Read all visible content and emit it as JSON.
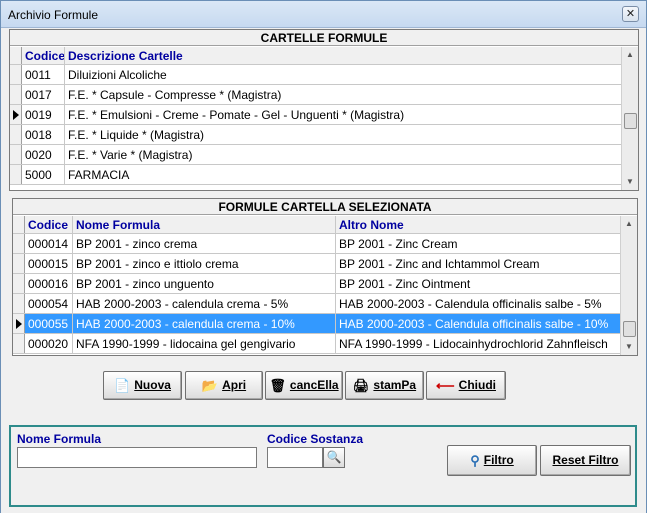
{
  "window": {
    "title": "Archivio Formule",
    "close_glyph": "✕"
  },
  "cartelle": {
    "caption": "CARTELLE FORMULE",
    "columns": [
      "Codice",
      "Descrizione Cartelle"
    ],
    "rows": [
      {
        "codice": "0011",
        "descrizione": "Diluizioni Alcoliche",
        "current": false
      },
      {
        "codice": "0017",
        "descrizione": "F.E. * Capsule - Compresse * (Magistra)",
        "current": false
      },
      {
        "codice": "0019",
        "descrizione": "F.E. * Emulsioni - Creme - Pomate - Gel - Unguenti * (Magistra)",
        "current": true
      },
      {
        "codice": "0018",
        "descrizione": "F.E. * Liquide * (Magistra)",
        "current": false
      },
      {
        "codice": "0020",
        "descrizione": "F.E. * Varie * (Magistra)",
        "current": false
      },
      {
        "codice": "5000",
        "descrizione": "FARMACIA",
        "current": false
      }
    ]
  },
  "formule": {
    "caption": "FORMULE  CARTELLA SELEZIONATA",
    "columns": [
      "Codice",
      "Nome Formula",
      "Altro Nome"
    ],
    "rows": [
      {
        "codice": "000014",
        "nome": "BP 2001 - zinco crema",
        "altro": "BP 2001 - Zinc Cream",
        "selected": false
      },
      {
        "codice": "000015",
        "nome": "BP 2001 - zinco e ittiolo crema",
        "altro": "BP 2001 - Zinc and Ichtammol Cream",
        "selected": false
      },
      {
        "codice": "000016",
        "nome": "BP 2001 - zinco unguento",
        "altro": "BP 2001 - Zinc Ointment",
        "selected": false
      },
      {
        "codice": "000054",
        "nome": "HAB 2000-2003 - calendula crema -  5%",
        "altro": "HAB 2000-2003 - Calendula officinalis salbe -  5%",
        "selected": false
      },
      {
        "codice": "000055",
        "nome": "HAB 2000-2003 - calendula crema - 10%",
        "altro": "HAB 2000-2003 - Calendula officinalis salbe - 10%",
        "selected": true
      },
      {
        "codice": "000020",
        "nome": "NFA 1990-1999 - lidocaina gel gengivario",
        "altro": "NFA 1990-1999 - Lidocainhydrochlorid Zahnfleisch",
        "selected": false
      }
    ]
  },
  "toolbar": {
    "nuova": "Nuova",
    "apri": "Apri",
    "cancella": "cancElla",
    "stampa": "stamPa",
    "chiudi": "Chiudi"
  },
  "filter": {
    "nome_formula_label": "Nome Formula",
    "nome_formula_value": "",
    "codice_sostanza_label": "Codice Sostanza",
    "codice_sostanza_value": "",
    "filtro": "Filtro",
    "reset": "Reset Filtro"
  },
  "icons": {
    "nuova": "new-document-icon",
    "apri": "open-icon",
    "cancella": "delete-icon",
    "stampa": "print-icon",
    "chiudi": "back-arrow-icon",
    "filtro": "funnel-brush-icon",
    "pick": "lookup-icon"
  },
  "colors": {
    "selection": "#3399ff",
    "header_text": "#0000a0",
    "panel_border": "#2e8b8b",
    "chiudi_arrow": "#cc0000"
  }
}
